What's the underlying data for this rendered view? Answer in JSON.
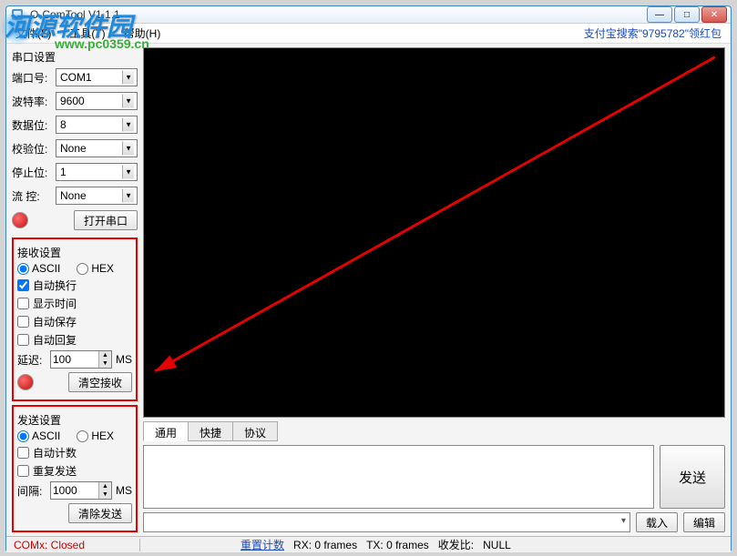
{
  "watermark": {
    "main": "河源软件园",
    "sub": "www.pc0359.cn"
  },
  "window": {
    "title": "O-ComTool V1.1.1"
  },
  "menu": {
    "file": "文件(F)",
    "tools": "工具(T)",
    "help": "帮助(H)"
  },
  "alipay": "支付宝搜索\"9795782\"领红包",
  "serial": {
    "group": "串口设置",
    "port_label": "端口号:",
    "port_value": "COM1",
    "baud_label": "波特率:",
    "baud_value": "9600",
    "data_label": "数据位:",
    "data_value": "8",
    "parity_label": "校验位:",
    "parity_value": "None",
    "stop_label": "停止位:",
    "stop_value": "1",
    "flow_label": "流 控:",
    "flow_value": "None",
    "open_btn": "打开串口"
  },
  "recv": {
    "group": "接收设置",
    "ascii": "ASCII",
    "hex": "HEX",
    "autowrap": "自动换行",
    "showtime": "显示时间",
    "autosave": "自动保存",
    "autoreply": "自动回复",
    "delay_label": "延迟:",
    "delay_value": "100",
    "delay_unit": "MS",
    "clear_btn": "清空接收"
  },
  "send": {
    "group": "发送设置",
    "ascii": "ASCII",
    "hex": "HEX",
    "autocount": "自动计数",
    "repeat": "重复发送",
    "interval_label": "间隔:",
    "interval_value": "1000",
    "interval_unit": "MS",
    "clear_btn": "清除发送"
  },
  "tabs": {
    "general": "通用",
    "quick": "快捷",
    "protocol": "协议"
  },
  "send_btn": "发送",
  "load_btn": "载入",
  "edit_btn": "编辑",
  "status": {
    "port": "COMx: Closed",
    "reset": "重置计数",
    "rx": "RX: 0 frames",
    "tx": "TX: 0 frames",
    "ratio_label": "收发比:",
    "ratio_value": "NULL"
  }
}
